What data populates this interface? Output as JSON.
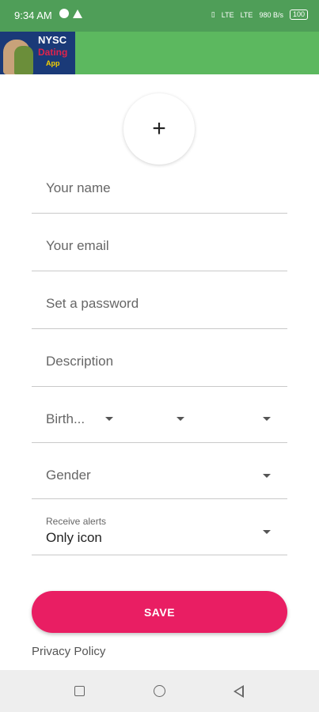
{
  "status_bar": {
    "time": "9:34 AM",
    "net1": "LTE",
    "net2": "LTE",
    "speed": "980 B/s",
    "battery": "100"
  },
  "app_bar": {
    "logo_line1": "NYSC",
    "logo_line2": "Dating",
    "logo_line3": "App"
  },
  "avatar": {
    "icon": "plus-icon"
  },
  "form": {
    "name_placeholder": "Your name",
    "email_placeholder": "Your email",
    "password_placeholder": "Set a password",
    "description_placeholder": "Description",
    "birth_label": "Birth...",
    "gender_label": "Gender",
    "alerts_label": "Receive alerts",
    "alerts_value": "Only icon"
  },
  "save_label": "SAVE",
  "privacy_label": "Privacy Policy",
  "colors": {
    "status_bar": "#4f9e58",
    "app_bar": "#5cb85f",
    "accent": "#e91e63"
  }
}
